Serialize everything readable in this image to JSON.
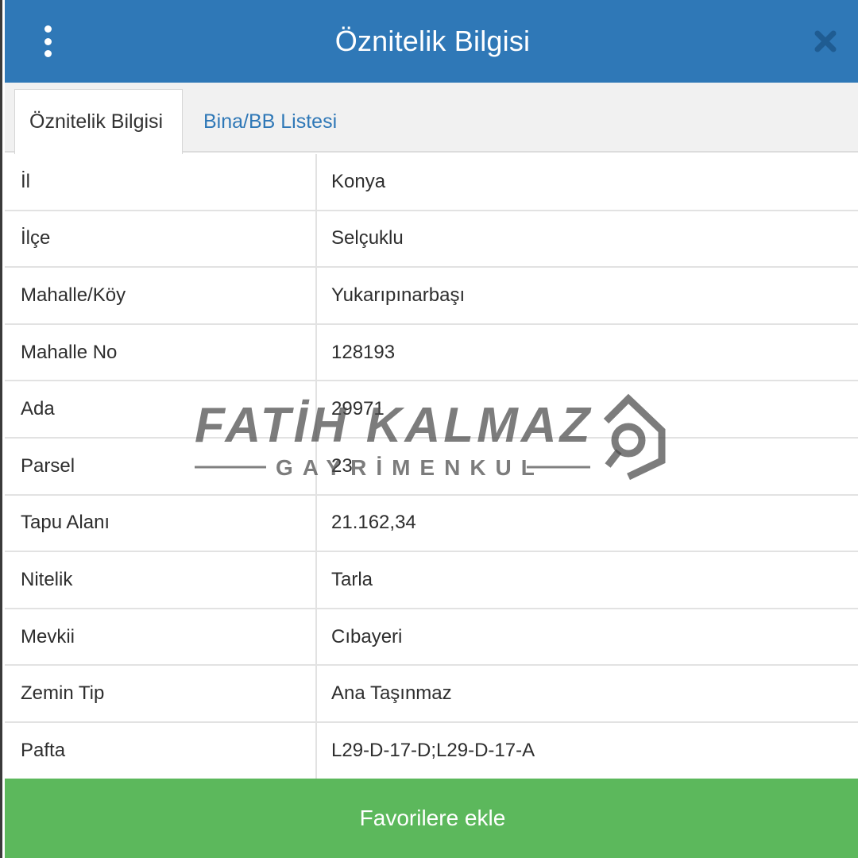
{
  "header": {
    "title": "Öznitelik Bilgisi",
    "menu_icon": "kebab-menu-icon",
    "close_icon": "close-icon"
  },
  "tabs": [
    {
      "label": "Öznitelik Bilgisi",
      "active": true
    },
    {
      "label": "Bina/BB Listesi",
      "active": false
    }
  ],
  "attributes": [
    {
      "key": "İl",
      "value": "Konya"
    },
    {
      "key": "İlçe",
      "value": "Selçuklu"
    },
    {
      "key": "Mahalle/Köy",
      "value": "Yukarıpınarbaşı"
    },
    {
      "key": "Mahalle No",
      "value": "128193"
    },
    {
      "key": "Ada",
      "value": "29971"
    },
    {
      "key": "Parsel",
      "value": "23"
    },
    {
      "key": "Tapu Alanı",
      "value": "21.162,34"
    },
    {
      "key": "Nitelik",
      "value": "Tarla"
    },
    {
      "key": "Mevkii",
      "value": "Cıbayeri"
    },
    {
      "key": "Zemin Tip",
      "value": "Ana Taşınmaz"
    },
    {
      "key": "Pafta",
      "value": "L29-D-17-D;L29-D-17-A"
    }
  ],
  "footer": {
    "favorite_label": "Favorilere ekle"
  },
  "watermark": {
    "name": "FATİH KALMAZ",
    "sub": "GAYRİMENKUL"
  },
  "colors": {
    "header": "#2f78b7",
    "tab_link": "#2f78b7",
    "favorite_button": "#5cb85c"
  }
}
